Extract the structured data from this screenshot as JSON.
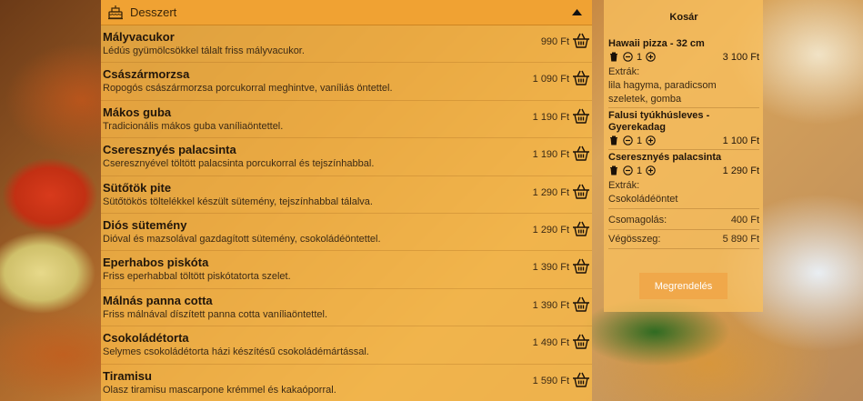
{
  "category": {
    "title": "Desszert",
    "icon": "cake-icon",
    "toggle_icon": "caret-up-icon"
  },
  "menu_items": [
    {
      "name": "Mályvacukor",
      "desc": "Lédús gyümölcsökkel tálalt friss mályvacukor.",
      "price": "990 Ft"
    },
    {
      "name": "Császármorzsa",
      "desc": "Ropogós császármorzsa porcukorral meghintve, vaníliás öntettel.",
      "price": "1 090 Ft"
    },
    {
      "name": "Mákos guba",
      "desc": "Tradicionális mákos guba vaníliaöntettel.",
      "price": "1 190 Ft"
    },
    {
      "name": "Cseresznyés palacsinta",
      "desc": "Cseresznyével töltött palacsinta porcukorral és tejszínhabbal.",
      "price": "1 190 Ft"
    },
    {
      "name": "Sütőtök pite",
      "desc": "Sütőtökös töltelékkel készült sütemény, tejszínhabbal tálalva.",
      "price": "1 290 Ft"
    },
    {
      "name": "Diós sütemény",
      "desc": "Dióval és mazsolával gazdagított sütemény, csokoládéöntettel.",
      "price": "1 290 Ft"
    },
    {
      "name": "Eperhabos piskóta",
      "desc": "Friss eperhabbal töltött piskótatorta szelet.",
      "price": "1 390 Ft"
    },
    {
      "name": "Málnás panna cotta",
      "desc": "Friss málnával díszített panna cotta vaníliaöntettel.",
      "price": "1 390 Ft"
    },
    {
      "name": "Csokoládétorta",
      "desc": "Selymes csokoládétorta házi készítésű csokoládémártással.",
      "price": "1 490 Ft"
    },
    {
      "name": "Tiramisu",
      "desc": "Olasz tiramisu mascarpone krémmel és kakaóporral.",
      "price": "1 590 Ft"
    }
  ],
  "cart": {
    "title": "Kosár",
    "items": [
      {
        "name": "Hawaii pizza - 32 cm",
        "qty": "1",
        "price": "3 100 Ft",
        "extras_label": "Extrák:",
        "extras": [
          "lila hagyma, paradicsom",
          "szeletek, gomba"
        ]
      },
      {
        "name": "Falusi tyúkhúsleves - Gyerekadag",
        "qty": "1",
        "price": "1 100 Ft",
        "extras_label": "",
        "extras": []
      },
      {
        "name": "Cseresznyés palacsinta",
        "qty": "1",
        "price": "1 290 Ft",
        "extras_label": "Extrák:",
        "extras": [
          "Csokoládéöntet"
        ]
      }
    ],
    "packaging_label": "Csomagolás:",
    "packaging_value": "400 Ft",
    "total_label": "Végösszeg:",
    "total_value": "5 890 Ft",
    "order_button": "Megrendelés"
  }
}
